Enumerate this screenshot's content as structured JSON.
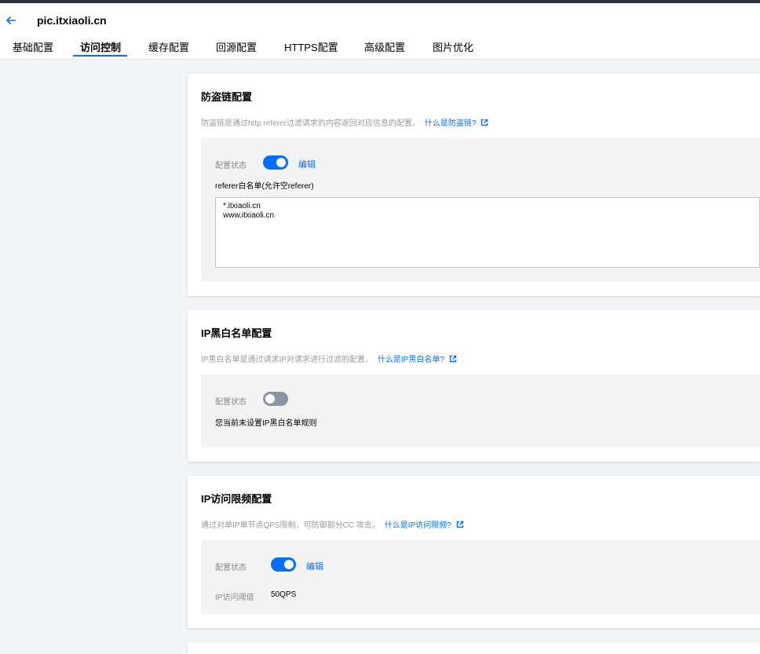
{
  "header": {
    "back_icon": "arrow-left-icon",
    "domain": "pic.itxiaoli.cn"
  },
  "tabs": [
    {
      "label": "基础配置",
      "active": false
    },
    {
      "label": "访问控制",
      "active": true
    },
    {
      "label": "缓存配置",
      "active": false
    },
    {
      "label": "回源配置",
      "active": false
    },
    {
      "label": "HTTPS配置",
      "active": false
    },
    {
      "label": "高级配置",
      "active": false
    },
    {
      "label": "图片优化",
      "active": false
    }
  ],
  "hotlink": {
    "title": "防盗链配置",
    "desc": "防盗链是通过http referer过滤请求的内容返回对应信息的配置。",
    "link": "什么是防盗链?",
    "status_label": "配置状态",
    "enabled": true,
    "edit": "编辑",
    "list_label": "referer白名单(允许空referer)",
    "whitelist": "*.itxiaoli.cn\nwww.itxiaoli.cn"
  },
  "ip_filter": {
    "title": "IP黑白名单配置",
    "desc": "IP黑白名单是通过请求IP对请求进行过滤的配置。",
    "link": "什么是IP黑白名单?",
    "status_label": "配置状态",
    "enabled": false,
    "empty_text": "您当前未设置IP黑白名单规则"
  },
  "ip_freq": {
    "title": "IP访问限频配置",
    "desc": "通过对单IP单节点QPS限制，可防御部分CC 攻击。",
    "link": "什么是IP访问限频?",
    "status_label": "配置状态",
    "enabled": true,
    "edit": "编辑",
    "threshold_label": "IP访问阈值",
    "threshold_value": "50QPS"
  },
  "colors": {
    "accent": "#006eff",
    "toggle_off": "#8a95a3",
    "page_bg": "#f2f4f7"
  },
  "icons": {
    "external_link": "external-link-icon"
  }
}
